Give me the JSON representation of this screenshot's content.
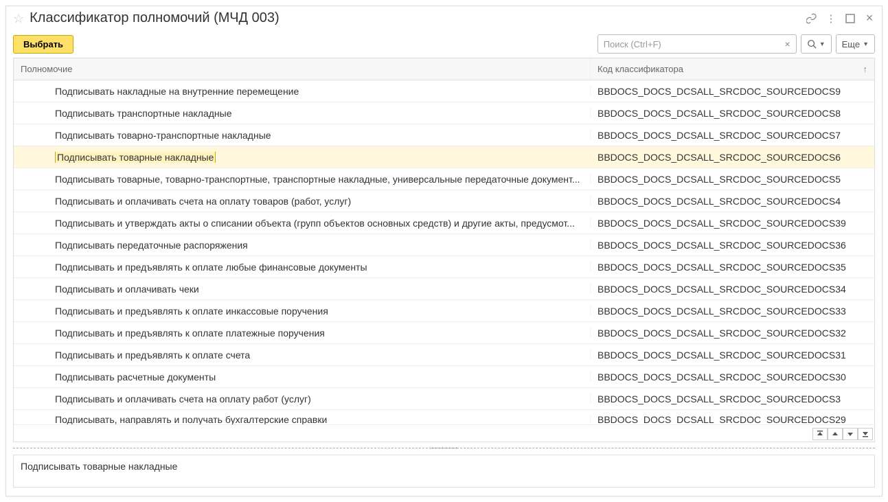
{
  "header": {
    "title": "Классификатор полномочий (МЧД 003)"
  },
  "toolbar": {
    "select_label": "Выбрать",
    "search_placeholder": "Поиск (Ctrl+F)",
    "more_label": "Еще"
  },
  "table": {
    "col1_label": "Полномочие",
    "col2_label": "Код классификатора",
    "rows": [
      {
        "name": "Подписывать накладные на внутренние перемещение",
        "code": "BBDOCS_DOCS_DCSALL_SRCDOC_SOURCEDOCS9"
      },
      {
        "name": "Подписывать транспортные накладные",
        "code": "BBDOCS_DOCS_DCSALL_SRCDOC_SOURCEDOCS8"
      },
      {
        "name": "Подписывать товарно-транспортные накладные",
        "code": "BBDOCS_DOCS_DCSALL_SRCDOC_SOURCEDOCS7"
      },
      {
        "name": "Подписывать товарные накладные",
        "code": "BBDOCS_DOCS_DCSALL_SRCDOC_SOURCEDOCS6",
        "selected": true
      },
      {
        "name": "Подписывать товарные, товарно-транспортные, транспортные накладные, универсальные передаточные документ...",
        "code": "BBDOCS_DOCS_DCSALL_SRCDOC_SOURCEDOCS5"
      },
      {
        "name": "Подписывать и оплачивать счета на оплату товаров (работ, услуг)",
        "code": "BBDOCS_DOCS_DCSALL_SRCDOC_SOURCEDOCS4"
      },
      {
        "name": "Подписывать и утверждать акты о списании объекта (групп объектов основных средств) и другие акты, предусмот...",
        "code": "BBDOCS_DOCS_DCSALL_SRCDOC_SOURCEDOCS39"
      },
      {
        "name": "Подписывать передаточные распоряжения",
        "code": "BBDOCS_DOCS_DCSALL_SRCDOC_SOURCEDOCS36"
      },
      {
        "name": "Подписывать и предъявлять к оплате любые финансовые документы",
        "code": "BBDOCS_DOCS_DCSALL_SRCDOC_SOURCEDOCS35"
      },
      {
        "name": "Подписывать и оплачивать чеки",
        "code": "BBDOCS_DOCS_DCSALL_SRCDOC_SOURCEDOCS34"
      },
      {
        "name": "Подписывать и предъявлять к оплате инкассовые поручения",
        "code": "BBDOCS_DOCS_DCSALL_SRCDOC_SOURCEDOCS33"
      },
      {
        "name": "Подписывать и предъявлять к оплате платежные поручения",
        "code": "BBDOCS_DOCS_DCSALL_SRCDOC_SOURCEDOCS32"
      },
      {
        "name": "Подписывать и предъявлять к оплате счета",
        "code": "BBDOCS_DOCS_DCSALL_SRCDOC_SOURCEDOCS31"
      },
      {
        "name": "Подписывать расчетные документы",
        "code": "BBDOCS_DOCS_DCSALL_SRCDOC_SOURCEDOCS30"
      },
      {
        "name": "Подписывать и оплачивать счета на оплату работ (услуг)",
        "code": "BBDOCS_DOCS_DCSALL_SRCDOC_SOURCEDOCS3"
      },
      {
        "name": "Подписывать, направлять и получать бухгалтерские справки",
        "code": "BBDOCS_DOCS_DCSALL_SRCDOC_SOURCEDOCS29",
        "partial": true
      }
    ]
  },
  "detail": {
    "text": "Подписывать товарные накладные"
  }
}
